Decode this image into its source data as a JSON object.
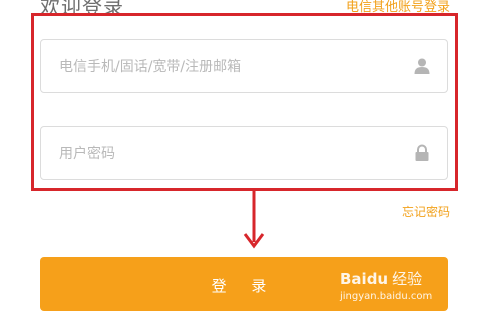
{
  "header": {
    "title": "欢迎登录",
    "other_login": "电信其他账号登录"
  },
  "form": {
    "account_placeholder": "电信手机/固话/宽带/注册邮箱",
    "password_placeholder": "用户密码",
    "forgot_password": "忘记密码",
    "login_button": "登 录"
  },
  "icons": {
    "account": "user-icon",
    "password": "lock-icon"
  },
  "watermark": {
    "brand": "Baidu",
    "brand_cn": "经验",
    "url": "jingyan.baidu.com"
  },
  "colors": {
    "accent": "#f6a01a",
    "annotation": "#d7262b",
    "link": "#f2a11b"
  }
}
